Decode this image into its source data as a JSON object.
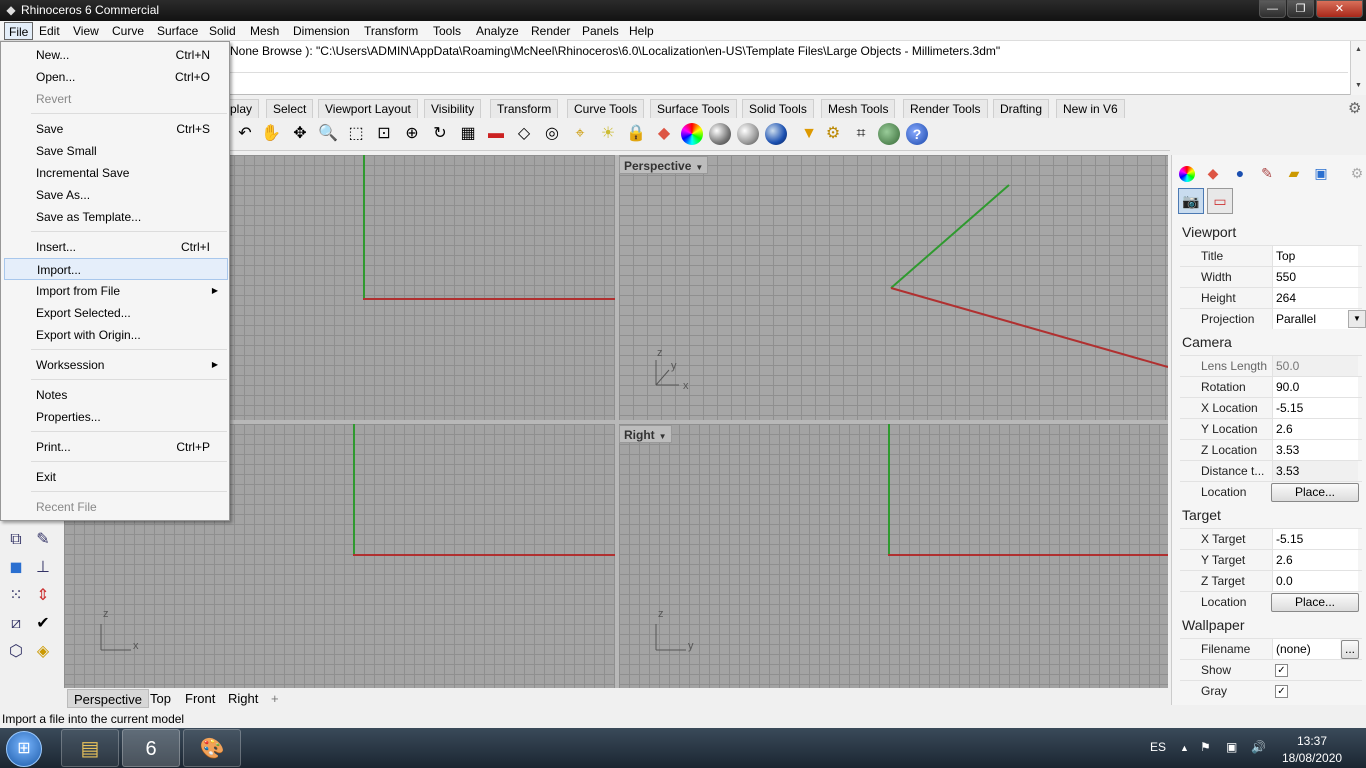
{
  "window": {
    "title": "Rhinoceros 6 Commercial",
    "minimize": "—",
    "maximize": "❐",
    "close": "✕"
  },
  "menubar": [
    "File",
    "Edit",
    "View",
    "Curve",
    "Surface",
    "Solid",
    "Mesh",
    "Dimension",
    "Transform",
    "Tools",
    "Analyze",
    "Render",
    "Panels",
    "Help"
  ],
  "command_history": "None  Browse ): \"C:\\Users\\ADMIN\\AppData\\Roaming\\McNeel\\Rhinoceros\\6.0\\Localization\\en-US\\Template Files\\Large Objects - Millimeters.3dm\"",
  "toolbar_tabs": [
    "play",
    "Select",
    "Viewport Layout",
    "Visibility",
    "Transform",
    "Curve Tools",
    "Surface Tools",
    "Solid Tools",
    "Mesh Tools",
    "Render Tools",
    "Drafting",
    "New in V6"
  ],
  "toolbar_icons": [
    "undo-icon",
    "pan-hand-icon",
    "rotate-view-icon",
    "zoom-icon",
    "zoom-window-icon",
    "zoom-extents-icon",
    "zoom-selected-icon",
    "rotate-camera-icon",
    "four-viewports-icon",
    "car-icon",
    "named-view-icon",
    "target-icon",
    "lights-icon",
    "lock-icon",
    "material-icon",
    "color-wheel-icon",
    "shaded-sphere-icon",
    "rendered-sphere-icon",
    "blue-sphere-icon",
    "filter-icon",
    "gears-icon",
    "select-icon",
    "globe-icon",
    "help-icon"
  ],
  "viewports": {
    "perspective": {
      "label": "Perspective",
      "axes": [
        "z",
        "y",
        "x"
      ]
    },
    "right": {
      "label": "Right",
      "axes": [
        "z",
        "y"
      ]
    },
    "front": {
      "axes": [
        "z",
        "x"
      ]
    }
  },
  "file_menu": {
    "items": [
      {
        "label": "New...",
        "shortcut": "Ctrl+N"
      },
      {
        "label": "Open...",
        "shortcut": "Ctrl+O"
      },
      {
        "label": "Revert",
        "shortcut": "",
        "disabled": true
      },
      {
        "label": "Save",
        "shortcut": "Ctrl+S"
      },
      {
        "label": "Save Small",
        "shortcut": ""
      },
      {
        "label": "Incremental Save",
        "shortcut": ""
      },
      {
        "label": "Save As...",
        "shortcut": ""
      },
      {
        "label": "Save as Template...",
        "shortcut": ""
      },
      {
        "label": "Insert...",
        "shortcut": "Ctrl+I"
      },
      {
        "label": "Import...",
        "shortcut": "",
        "highlighted": true
      },
      {
        "label": "Import from File",
        "shortcut": "",
        "submenu": true
      },
      {
        "label": "Export Selected...",
        "shortcut": ""
      },
      {
        "label": "Export with Origin...",
        "shortcut": ""
      },
      {
        "label": "Worksession",
        "shortcut": "",
        "submenu": true
      },
      {
        "label": "Notes",
        "shortcut": ""
      },
      {
        "label": "Properties...",
        "shortcut": ""
      },
      {
        "label": "Print...",
        "shortcut": "Ctrl+P"
      },
      {
        "label": "Exit",
        "shortcut": ""
      },
      {
        "label": "Recent File",
        "shortcut": "",
        "disabled": true
      }
    ]
  },
  "bottom_tabs": [
    "Perspective",
    "Top",
    "Front",
    "Right",
    "+"
  ],
  "status_text": "Import a file into the current model",
  "panel": {
    "viewport_section": "Viewport",
    "title_label": "Title",
    "title_value": "Top",
    "width_label": "Width",
    "width_value": "550",
    "height_label": "Height",
    "height_value": "264",
    "projection_label": "Projection",
    "projection_value": "Parallel",
    "camera_section": "Camera",
    "lens_label": "Lens Length",
    "lens_value": "50.0",
    "rotation_label": "Rotation",
    "rotation_value": "90.0",
    "xloc_label": "X Location",
    "xloc_value": "-5.15",
    "yloc_label": "Y Location",
    "yloc_value": "2.6",
    "zloc_label": "Z Location",
    "zloc_value": "3.53",
    "dist_label": "Distance t...",
    "dist_value": "3.53",
    "location_label": "Location",
    "place_button": "Place...",
    "target_section": "Target",
    "xtarget_label": "X Target",
    "xtarget_value": "-5.15",
    "ytarget_label": "Y Target",
    "ytarget_value": "2.6",
    "ztarget_label": "Z Target",
    "ztarget_value": "0.0",
    "wallpaper_section": "Wallpaper",
    "filename_label": "Filename",
    "filename_value": "(none)",
    "browse_button": "...",
    "show_label": "Show",
    "gray_label": "Gray"
  },
  "taskbar": {
    "lang": "ES",
    "time": "13:37",
    "date": "18/08/2020",
    "rhino_badge": "6"
  }
}
